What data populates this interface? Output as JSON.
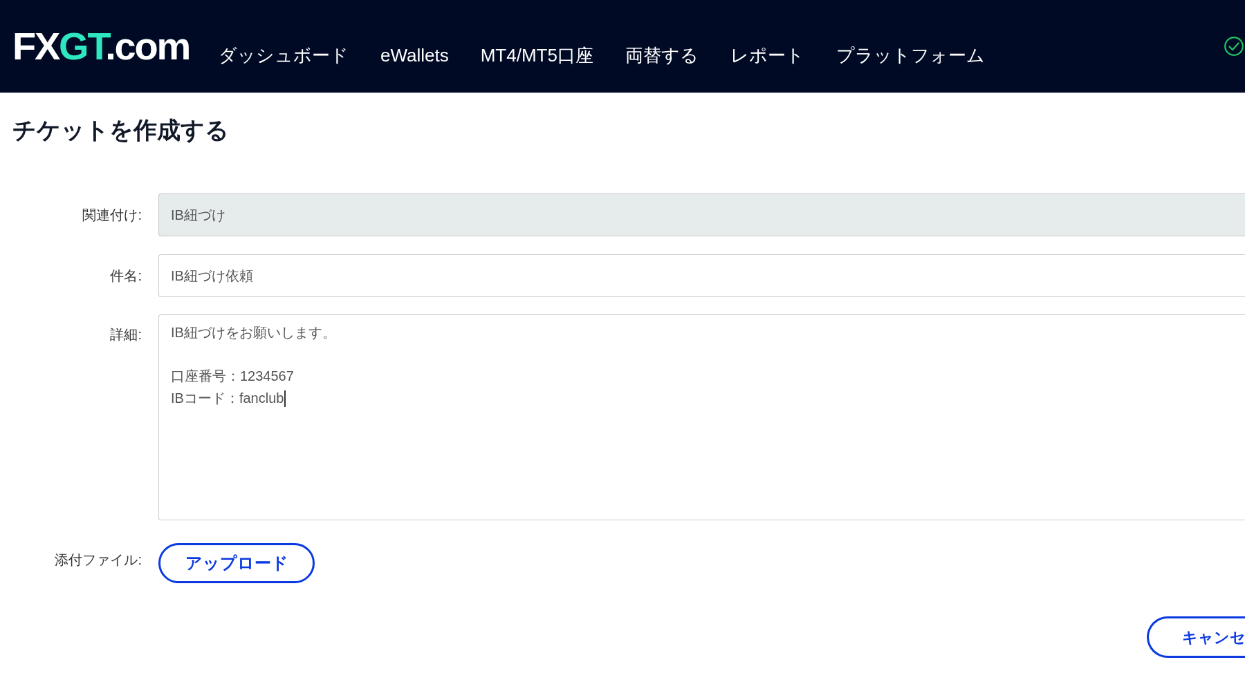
{
  "header": {
    "logo": [
      {
        "text": "FX",
        "color": "#ffffff"
      },
      {
        "text": "GT",
        "color": "#2ee6c0"
      },
      {
        "text": ".com",
        "color": "#ffffff"
      }
    ],
    "nav": [
      {
        "label": "ダッシュボード"
      },
      {
        "label": "eWallets"
      },
      {
        "label": "MT4/MT5口座"
      },
      {
        "label": "両替する"
      },
      {
        "label": "レポート"
      },
      {
        "label": "プラットフォーム"
      }
    ]
  },
  "page_title": "チケットを作成する",
  "form": {
    "rows": [
      {
        "kind": "input",
        "label": "関連付け:",
        "value": "IB紐づけ",
        "disabled": true
      },
      {
        "kind": "input",
        "label": "件名:",
        "value": "IB紐づけ依頼",
        "disabled": false
      },
      {
        "kind": "textarea",
        "label": "詳細:",
        "paragraphs": [
          [
            "IB紐づけをお願いします。"
          ],
          [
            "口座番号：1234567",
            "IBコード：fanclub"
          ]
        ],
        "focused": true
      },
      {
        "kind": "upload",
        "label": "添付ファイル:",
        "button": "アップロード"
      }
    ],
    "actions": [
      {
        "label": "キャンセ"
      }
    ]
  }
}
